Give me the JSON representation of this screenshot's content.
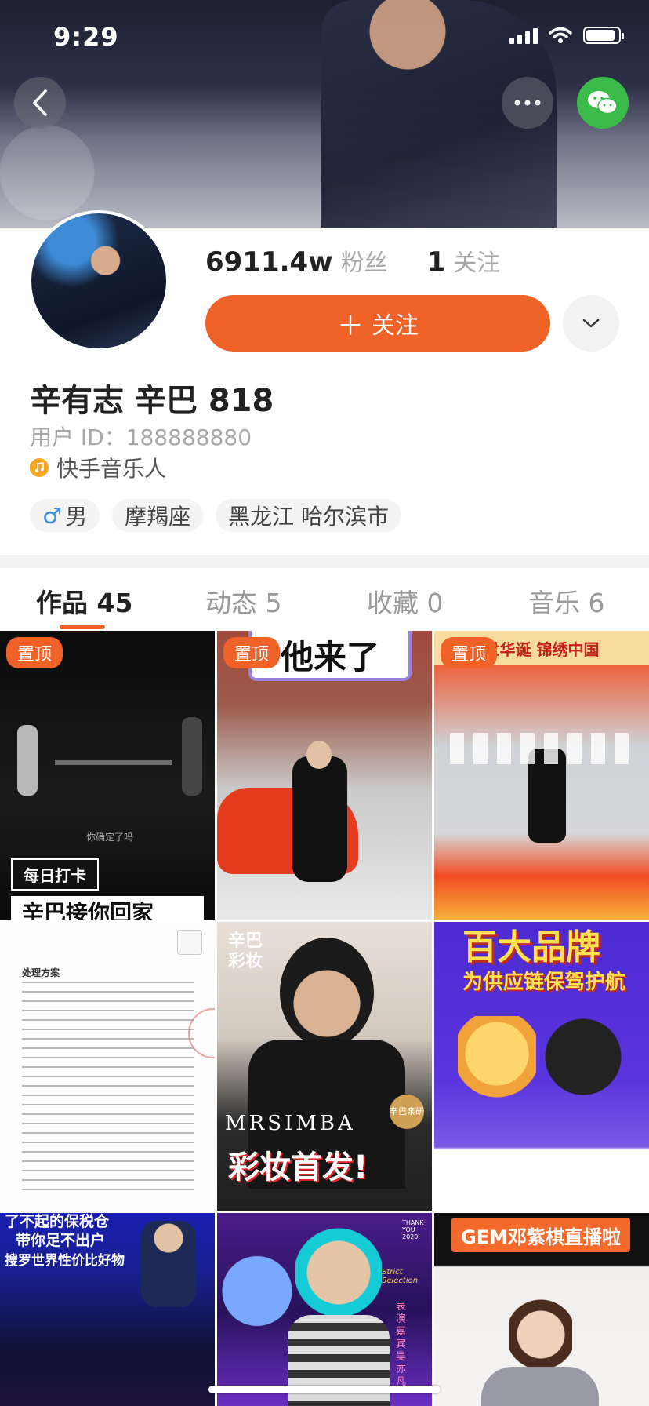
{
  "status_bar": {
    "time": "9:29"
  },
  "header": {
    "back_icon": "chevron-left-icon",
    "more_icon": "more-dots-icon",
    "share_icon": "wechat-icon"
  },
  "profile": {
    "fans_count": "6911.4w",
    "fans_label": "粉丝",
    "following_count": "1",
    "following_label": "关注",
    "follow_button_label": "关注",
    "name": "辛有志 辛巴 818",
    "user_id": "用户 ID：188888880",
    "verified_label": "快手音乐人",
    "tags": {
      "gender": "男",
      "gender_symbol": "♂",
      "zodiac": "摩羯座",
      "location": "黑龙江 哈尔滨市"
    }
  },
  "tabs": [
    {
      "label": "作品 45",
      "active": true
    },
    {
      "label": "动态 5",
      "active": false
    },
    {
      "label": "收藏 0",
      "active": false
    },
    {
      "label": "音乐 6",
      "active": false
    }
  ],
  "grid": {
    "pinned_label": "置顶",
    "items": [
      {
        "text1": "你确定了吗",
        "text2": "每日打卡",
        "text3": "辛巴接你回家"
      },
      {
        "text1": "他来了"
      },
      {
        "text1": "世华诞 锦绣中国"
      },
      {
        "text1": "处理方案"
      },
      {
        "text1": "辛巴",
        "text2": "彩妆",
        "text3": "MRSIMBA",
        "text4": "彩妆首发!",
        "text5": "辛巴亲研"
      },
      {
        "text1": "百大品牌",
        "text2": "为供应链保驾护航"
      },
      {
        "text1": "了不起的保税仓",
        "text2": "带你足不出户",
        "text3": "搜罗世界性价比好物"
      },
      {
        "text1": "THANK YOU 2020",
        "text2": "Strict Selection",
        "text3": "表演嘉宾 吴亦凡"
      },
      {
        "text1": "GEM邓紫棋直播啦"
      }
    ]
  },
  "colors": {
    "accent": "#f06228",
    "wechat": "#3bbb4a",
    "verified": "#f5a623",
    "male": "#3b8be8"
  }
}
